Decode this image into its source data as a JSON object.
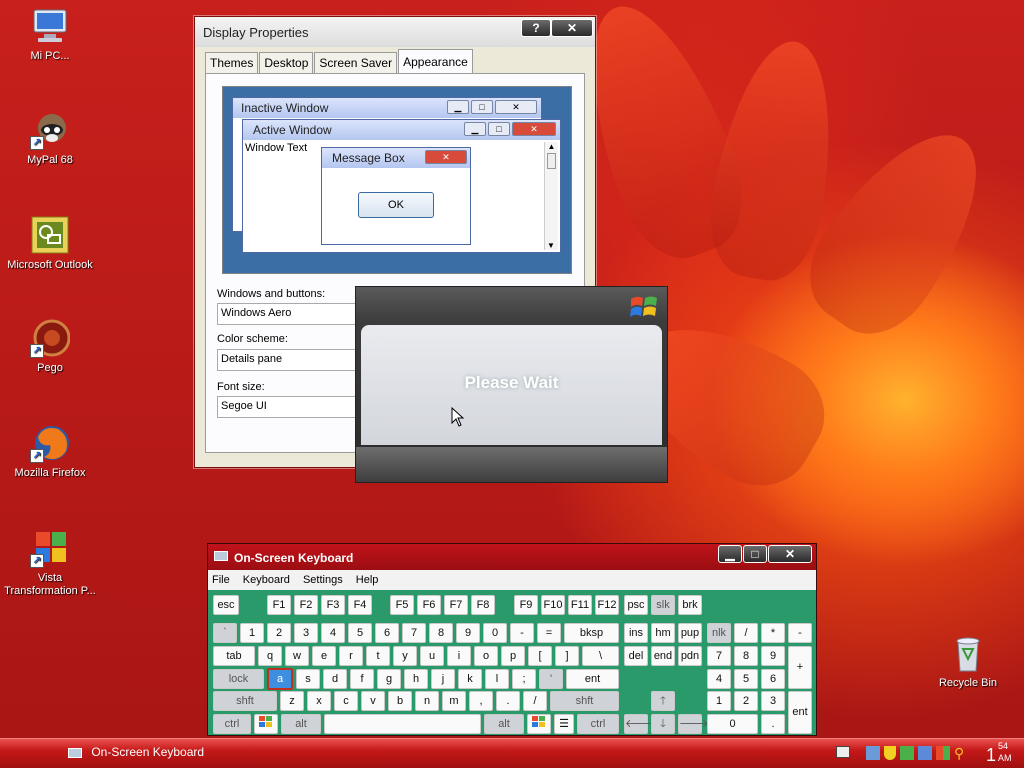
{
  "desktop": {
    "icons": [
      {
        "label": "Mi PC...",
        "icon": "computer-icon"
      },
      {
        "label": "MyPal 68",
        "icon": "raccoon-icon"
      },
      {
        "label": "Microsoft Outlook",
        "icon": "outlook-icon"
      },
      {
        "label": "Pego",
        "icon": "pego-icon"
      },
      {
        "label": "Mozilla Firefox",
        "icon": "firefox-icon"
      },
      {
        "label": "Vista Transformation P...",
        "icon": "vista-icon"
      },
      {
        "label": "Recycle Bin",
        "icon": "recycle-bin-icon"
      }
    ]
  },
  "display_properties": {
    "title": "Display Properties",
    "help_btn": "?",
    "close_btn": "✕",
    "tabs": [
      "Themes",
      "Desktop",
      "Screen Saver",
      "Appearance"
    ],
    "active_tab": "Appearance",
    "preview": {
      "inactive_title": "Inactive Window",
      "active_title": "Active Window",
      "window_text": "Window Text",
      "msgbox_title": "Message Box",
      "ok": "OK"
    },
    "windows_buttons_label": "Windows and buttons:",
    "windows_buttons_value": "Windows Aero",
    "color_scheme_label": "Color scheme:",
    "color_scheme_value": "Details pane",
    "font_size_label": "Font size:",
    "font_size_value": "Segoe UI"
  },
  "please_wait": {
    "text": "Please Wait"
  },
  "osk": {
    "title": "On-Screen Keyboard",
    "menu": [
      "File",
      "Keyboard",
      "Settings",
      "Help"
    ],
    "selected_key": "a"
  },
  "taskbar": {
    "task": "On-Screen Keyboard",
    "clock_top": "54",
    "clock_hour": "1",
    "clock_ampm": "AM"
  },
  "colors": {
    "osk_bg": "#2a9a6a",
    "titlebar_red": "#c1121a",
    "taskbar": "#c41818"
  }
}
